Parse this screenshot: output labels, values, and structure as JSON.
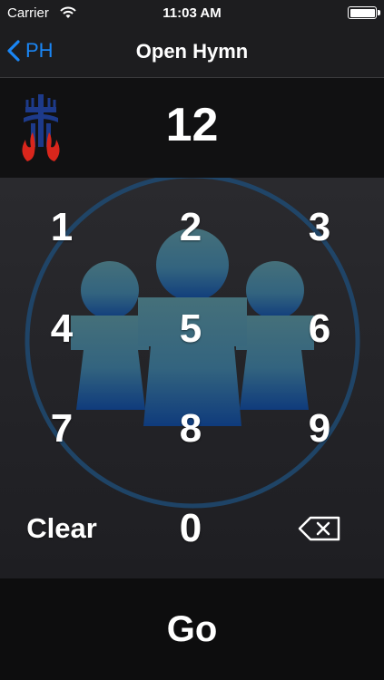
{
  "status_bar": {
    "carrier": "Carrier",
    "time": "11:03 AM",
    "wifi_icon": "wifi-icon",
    "battery_icon": "battery-icon",
    "battery_level": 1.0
  },
  "nav": {
    "back_label": "PH",
    "back_icon": "chevron-left-icon",
    "title": "Open Hymn"
  },
  "display": {
    "logo_icon": "presbyterian-seal-icon",
    "hymn_number": "12"
  },
  "keypad": {
    "keys": [
      "1",
      "2",
      "3",
      "4",
      "5",
      "6",
      "7",
      "8",
      "9"
    ],
    "clear_label": "Clear",
    "zero_label": "0",
    "backspace_icon": "backspace-icon"
  },
  "go_label": "Go",
  "colors": {
    "accent": "#1a86f5",
    "background": "#1b1b1d",
    "figures_top": "#45707a",
    "figures_bottom": "#0f3b7c",
    "logo_blue": "#1d3a8a",
    "logo_red": "#d9261c"
  }
}
